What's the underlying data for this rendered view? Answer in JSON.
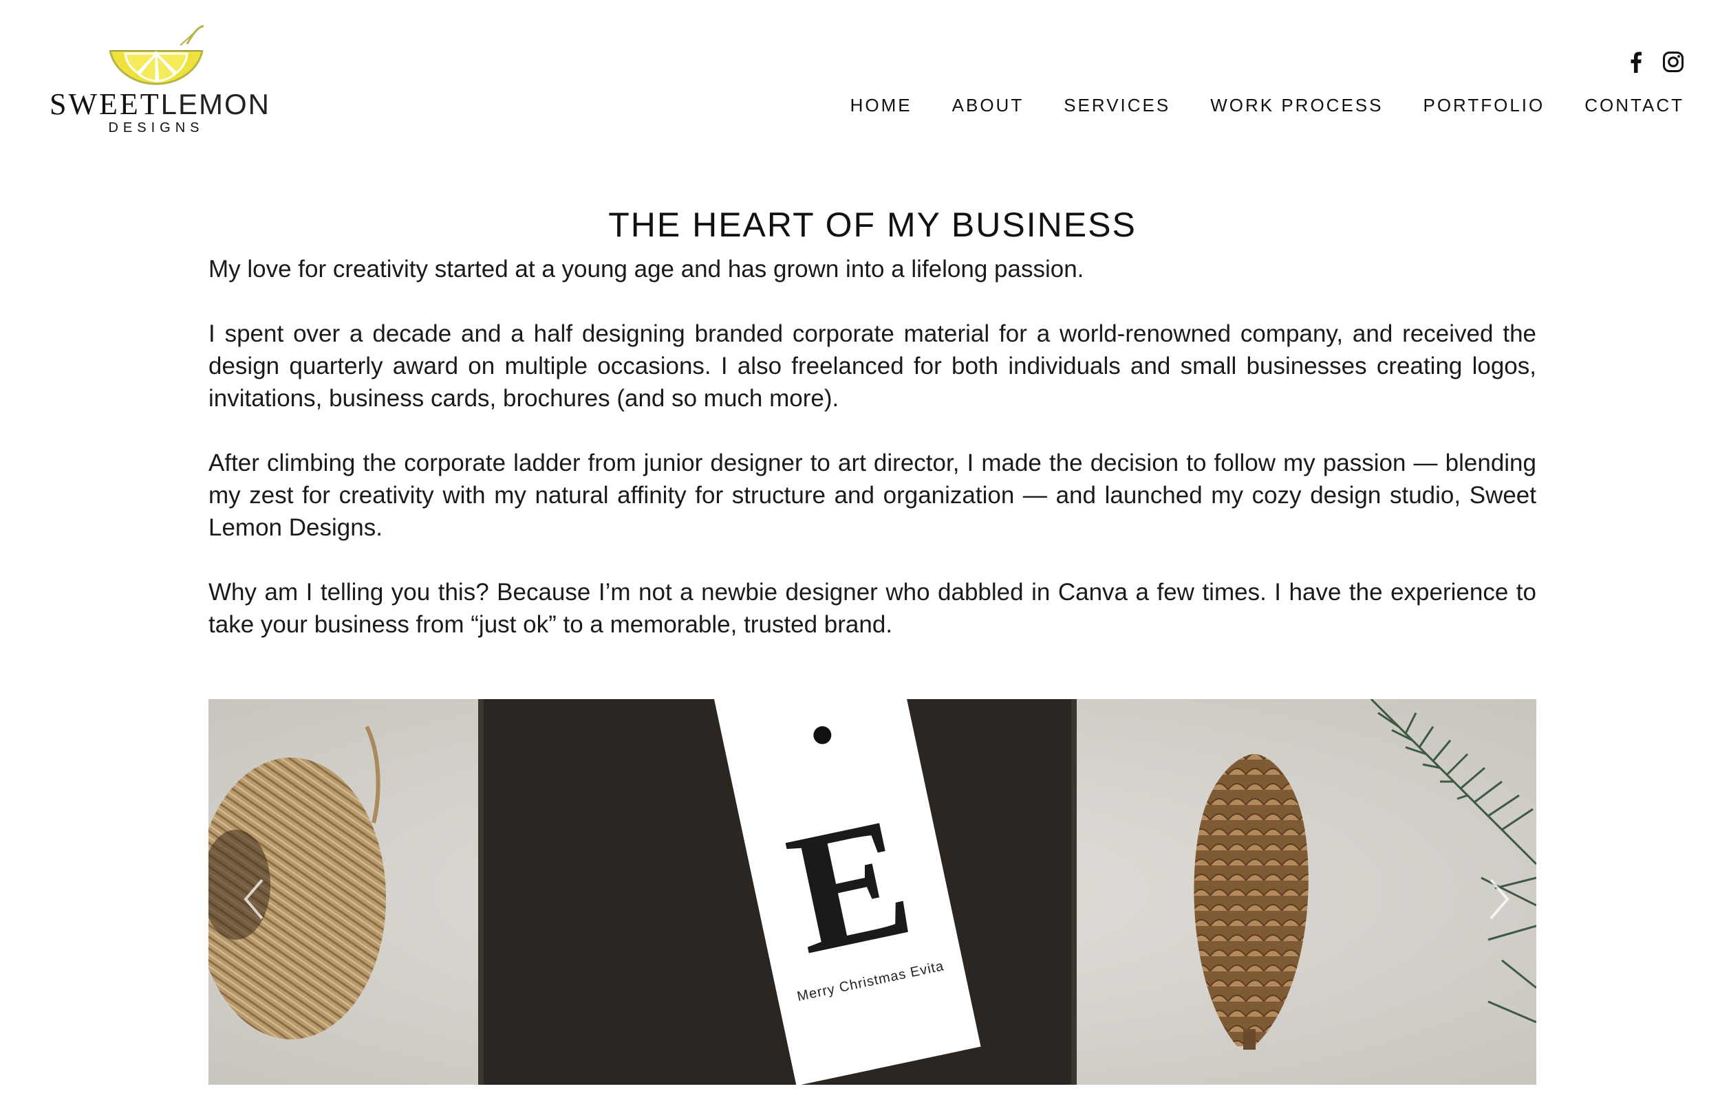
{
  "brand": {
    "name_strong": "SWEET",
    "name_light": "LEMON",
    "subline": "DESIGNS",
    "accent_color": "#E9D93A"
  },
  "social": [
    {
      "name": "facebook-icon"
    },
    {
      "name": "instagram-icon"
    }
  ],
  "nav": {
    "items": [
      "HOME",
      "ABOUT",
      "SERVICES",
      "WORK PROCESS",
      "PORTFOLIO",
      "CONTACT"
    ]
  },
  "main": {
    "heading": "THE HEART OF MY BUSINESS",
    "paragraphs": [
      "My love for creativity started at a young age and has grown into a lifelong passion.",
      "I spent over a decade and a half designing branded corporate material for a world-renowned company, and received the design quarterly award on multiple occasions. I also freelanced for both individuals and small businesses creating logos, invitations, business cards, brochures (and so much more).",
      "After climbing the corporate ladder from junior designer to art director, I made the decision to follow my passion — blending my zest for creativity with my natural affinity for structure and organization — and launched my cozy design studio, Sweet Lemon Designs.",
      "Why am I telling you this? Because I’m not a newbie designer who dabbled in Canva a few times. I have the experience to take your business from “just ok” to a memorable, trusted brand."
    ]
  },
  "slider": {
    "tag_letter": "E",
    "tag_caption": "Merry Christmas Evita",
    "prev_icon": "chevron-left-icon",
    "next_icon": "chevron-right-icon"
  }
}
